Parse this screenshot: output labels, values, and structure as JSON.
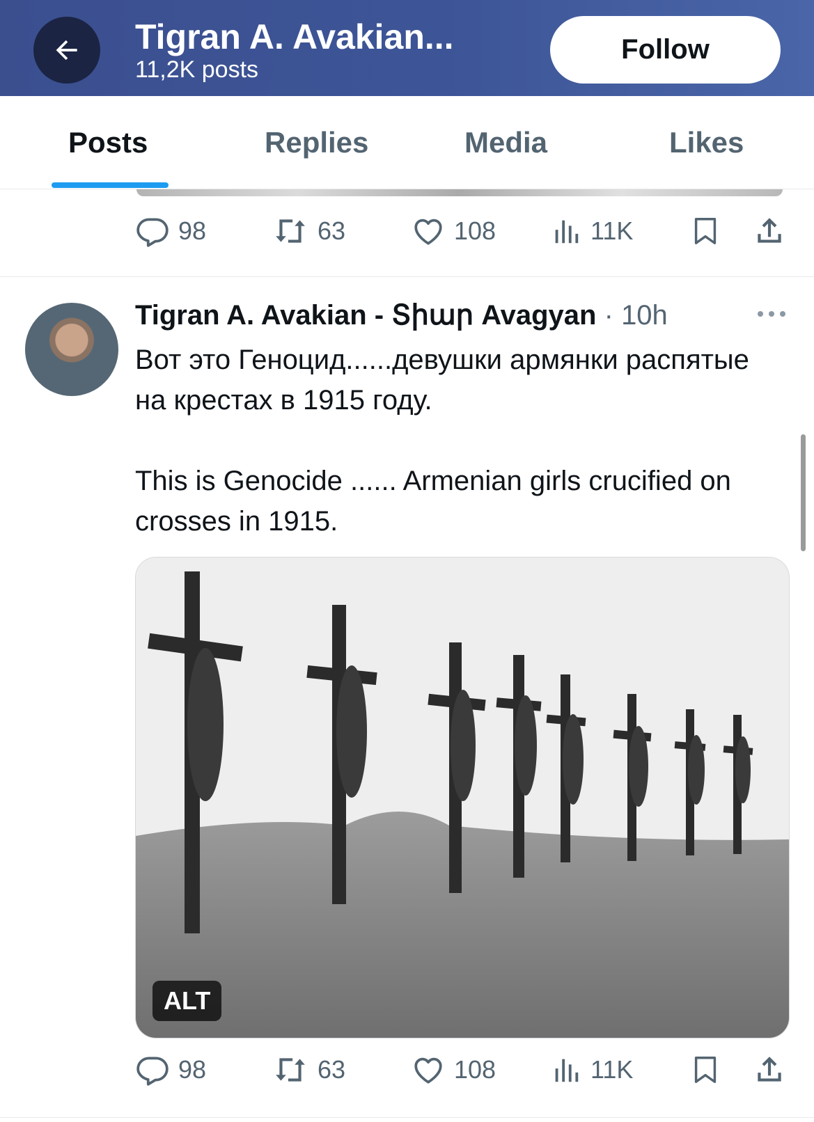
{
  "header": {
    "back_icon": "arrow-left-icon",
    "profile_name": "Tigran A. Avakian...",
    "post_count": "11,2K posts",
    "follow_label": "Follow"
  },
  "tabs": [
    {
      "label": "Posts",
      "active": true
    },
    {
      "label": "Replies",
      "active": false
    },
    {
      "label": "Media",
      "active": false
    },
    {
      "label": "Likes",
      "active": false
    }
  ],
  "previous_post_actions": {
    "replies": "98",
    "reposts": "63",
    "likes": "108",
    "views": "11K"
  },
  "tweet": {
    "author_name": "Tigran A. Avakian - Տիար Avagyan",
    "separator": "·",
    "time": "10h",
    "text": "Вот это Геноцид......девушки армянки распятые на крестах в 1915 году.\n\nThis is Genocide ...... Armenian girls crucified on crosses in 1915.",
    "media_alt_badge": "ALT",
    "actions": {
      "replies": "98",
      "reposts": "63",
      "likes": "108",
      "views": "11K"
    }
  },
  "colors": {
    "header_bg": "#3d5597",
    "accent": "#1d9bf0",
    "muted_text": "#536471"
  }
}
